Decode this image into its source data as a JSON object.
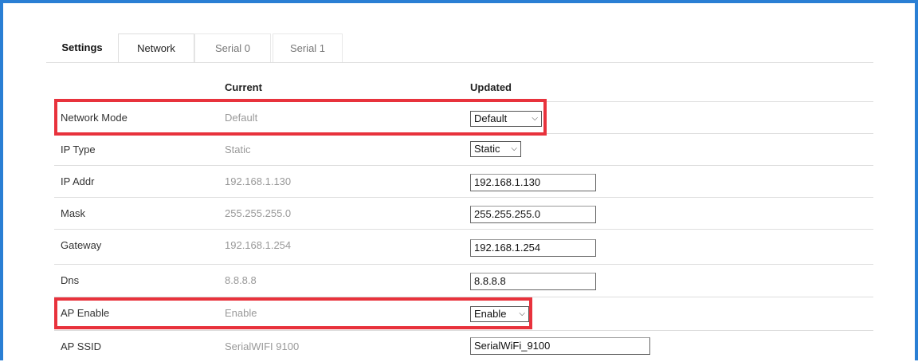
{
  "tabs": {
    "settings": "Settings",
    "network": "Network",
    "serial0": "Serial 0",
    "serial1": "Serial 1"
  },
  "columns": {
    "current": "Current",
    "updated": "Updated"
  },
  "rows": [
    {
      "label": "Network Mode",
      "current": "Default",
      "updated": "Default",
      "control": "select"
    },
    {
      "label": "IP Type",
      "current": "Static",
      "updated": "Static",
      "control": "select"
    },
    {
      "label": "IP Addr",
      "current": "192.168.1.130",
      "updated": "192.168.1.130",
      "control": "input"
    },
    {
      "label": "Mask",
      "current": "255.255.255.0",
      "updated": "255.255.255.0",
      "control": "input"
    },
    {
      "label": "Gateway",
      "current": "192.168.1.254",
      "updated": "192.168.1.254",
      "control": "input"
    },
    {
      "label": "Dns",
      "current": "8.8.8.8",
      "updated": "8.8.8.8",
      "control": "input"
    },
    {
      "label": "AP Enable",
      "current": "Enable",
      "updated": "Enable",
      "control": "select"
    },
    {
      "label": "AP SSID",
      "current": "SerialWIFI 9100",
      "updated": "SerialWiFi_9100",
      "control": "input"
    }
  ],
  "colors": {
    "frame": "#2a7fd4",
    "highlight": "#e8323c"
  },
  "icons": {
    "dropdown": "chevron-down-icon"
  }
}
